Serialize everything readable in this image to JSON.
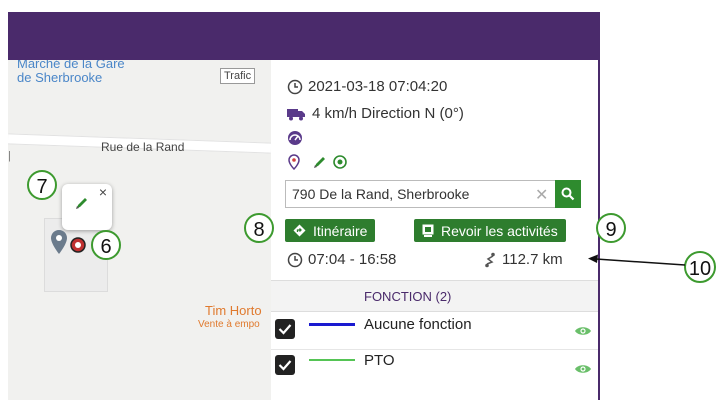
{
  "map": {
    "poi_line1": "Marché de la Gare",
    "poi_line2": "de Sherbrooke",
    "road_label": "Rue de la Rand",
    "trafic_button": "Trafic",
    "shop_name": "Tim Horto",
    "shop_subtitle": "Vente à empo",
    "popup_close": "×"
  },
  "callouts": {
    "c6": "6",
    "c7": "7",
    "c8": "8",
    "c9": "9",
    "c10": "10"
  },
  "panel": {
    "datetime": "2021-03-18 07:04:20",
    "speed_direction": "4 km/h Direction N (0°)",
    "address": "790 De la Rand, Sherbrooke",
    "itinerary_button": "Itinéraire",
    "activities_button": "Revoir les activités",
    "time_range": "07:04 - 16:58",
    "distance": "112.7 km"
  },
  "functions": {
    "header": "FONCTION (2)",
    "items": [
      {
        "label": "Aucune fonction",
        "color": "#1a1ad0",
        "checked": true
      },
      {
        "label": "PTO",
        "color": "#55c455",
        "checked": true
      }
    ]
  },
  "colors": {
    "header": "#4a2a6b",
    "accent_green": "#2e7d2e",
    "callout_border": "#3d9a2f"
  }
}
